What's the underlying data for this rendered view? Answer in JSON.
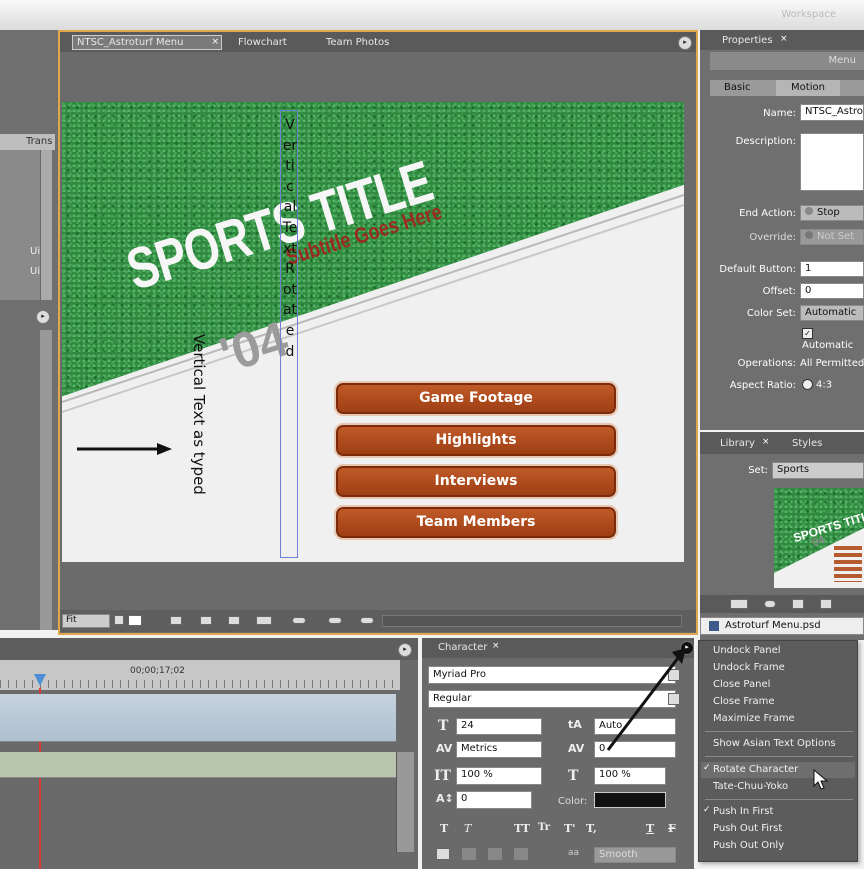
{
  "workspace_label": "Workspace",
  "monitor": {
    "tabs": [
      "NTSC_Astroturf Menu",
      "Flowchart",
      "Team Photos"
    ],
    "zoom_value": "Fit",
    "menu_buttons": [
      "Game Footage",
      "Highlights",
      "Interviews",
      "Team Members"
    ],
    "sports_title": "SPORTS TITLE",
    "subtitle": "Subtitle Goes Here",
    "year": "'04",
    "vertical_typed": "Vertical Text as typed",
    "vertical_rotated": "Vertical Text Rotated"
  },
  "left_strip": {
    "label1": "Trans",
    "label2": "Ui",
    "label3": "Ui"
  },
  "properties": {
    "tab": "Properties",
    "title_partial": "Menu",
    "subtabs": [
      "Basic",
      "Motion"
    ],
    "fields": {
      "name_label": "Name:",
      "name_value": "NTSC_Astro",
      "description_label": "Description:",
      "end_action_label": "End Action:",
      "end_action_value": "Stop",
      "override_label": "Override:",
      "override_value": "Not Set",
      "default_button_label": "Default Button:",
      "default_button_value": "1",
      "offset_label": "Offset:",
      "offset_value": "0",
      "color_set_label": "Color Set:",
      "color_set_value": "Automatic",
      "automatic_check": "Automatic",
      "operations_label": "Operations:",
      "operations_value": "All Permitted",
      "aspect_label": "Aspect Ratio:",
      "aspect_value": "4:3"
    }
  },
  "library": {
    "tabs": [
      "Library",
      "Styles"
    ],
    "set_label": "Set:",
    "set_value": "Sports",
    "thumb_title": "SPORTS TITL",
    "thumb_year": "'04",
    "file_name": "Astroturf Menu.psd"
  },
  "timeline": {
    "timecode": "00;00;17;02"
  },
  "character": {
    "tab": "Character",
    "font": "Myriad Pro",
    "style": "Regular",
    "size": "24",
    "leading": "Auto",
    "kerning": "Metrics",
    "tracking": "0",
    "vscale": "100 %",
    "hscale": "100 %",
    "baseline": "0",
    "color_label": "Color:",
    "color_value": "#111111",
    "antialias": "Smooth",
    "style_buttons": [
      "T",
      "T",
      "TT",
      "Tr",
      "T'",
      "T,",
      "T",
      "F"
    ]
  },
  "context_menu": {
    "group1": [
      "Undock Panel",
      "Undock Frame",
      "Close Panel",
      "Close Frame",
      "Maximize Frame"
    ],
    "group2": [
      "Show Asian Text Options"
    ],
    "group3": [
      "Rotate Character",
      "Tate-Chuu-Yoko"
    ],
    "group4": [
      "Push In First",
      "Push Out First",
      "Push Out Only"
    ],
    "checked": [
      "Rotate Character",
      "Push In First"
    ]
  },
  "colors": {
    "button": "#a8461a",
    "subtitle": "#9a2b1f",
    "grass": "#2f8a40",
    "frame_highlight": "#e0a84a"
  }
}
